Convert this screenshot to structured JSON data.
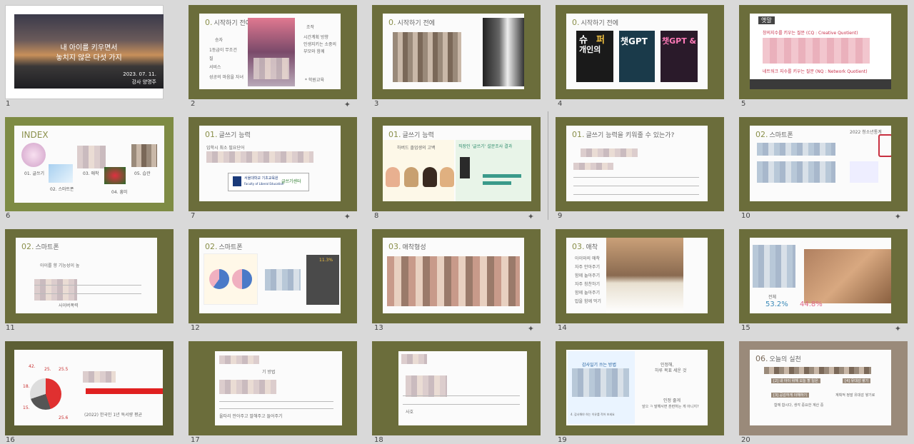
{
  "slides": [
    {
      "num": "1",
      "title_line1": "내 아이를 키우면서",
      "title_line2": "놓치지 않은 다섯 가지",
      "date": "2023. 07. 11.",
      "speaker": "강사  양명주"
    },
    {
      "num": "2",
      "section": "0.",
      "title": "시작하기 전에",
      "left_items": [
        "승자",
        "1등급이 무조건",
        "질",
        "서비스",
        "성공의 마음을 자녀"
      ],
      "right_head": "조작",
      "right_items": [
        "시간계획 방향",
        "인생지키는 소중의",
        "부모와 함께"
      ],
      "right_foot": "* 학원교육"
    },
    {
      "num": "3",
      "section": "0.",
      "title": "시작하기 전에"
    },
    {
      "num": "4",
      "section": "0.",
      "title": "시작하기 전에",
      "book1_a": "슈",
      "book1_b": "퍼",
      "book1_c": "개인의",
      "book2": "챗GPT",
      "book3": "챗GPT &"
    },
    {
      "num": "5",
      "head": "옛말",
      "line1": "창의지수를 키우는 질문 (CQ : Creative Quotient)",
      "line2": "네트워크 지수를 키우는 질문 (NQ : Network Quotient)"
    },
    {
      "num": "6",
      "title": "INDEX",
      "items": [
        "01. 글쓰기",
        "02. 스마트폰",
        "03. 애착",
        "04. 흥미",
        "05. 습관"
      ]
    },
    {
      "num": "7",
      "section": "01.",
      "title": "글쓰기 능력",
      "body": "입학시 최소 필요단어",
      "school": "서울대학교 기초교육원",
      "school_en": "Faculty of Liberal Education",
      "center": "글쓰기센터"
    },
    {
      "num": "8",
      "section": "01.",
      "title": "글쓰기 능력",
      "left_head": "하버드 졸업생의 고백",
      "right_head": "직장인 '글쓰기' 설문조사 결과"
    },
    {
      "num": "9",
      "section": "01.",
      "title": "글쓰기 능력을 키워줄 수 있는가?"
    },
    {
      "num": "10",
      "section": "02.",
      "title": "스마트폰",
      "note": "2022 청소년통계"
    },
    {
      "num": "11",
      "section": "02.",
      "title": "스마트폰",
      "body": "아이를 향 기능성이 높",
      "foot": "사이버폭력"
    },
    {
      "num": "12",
      "section": "02.",
      "title": "스마트폰",
      "value": "11.3%"
    },
    {
      "num": "13",
      "section": "03.",
      "title": "애착형성"
    },
    {
      "num": "14",
      "section": "03.",
      "title": "애착",
      "items": [
        "아이와의 애착",
        "자주 안아주기",
        "함께 놀아주기",
        "자주 칭찬하기",
        "함께 놀아주기",
        "밥을 함께 먹기"
      ]
    },
    {
      "num": "15",
      "value_a": "53.2%",
      "value_b": "44.8%",
      "label": "전체"
    },
    {
      "num": "16",
      "nums": [
        "42.",
        "25.",
        "25.5",
        "18.",
        "15.",
        "25.6"
      ],
      "foot": "(2022) 한국인 1년 독서량 평균"
    },
    {
      "num": "17",
      "title": "기 방법",
      "foot": "울타리 안아주고 말해주고 들어주기"
    },
    {
      "num": "18",
      "foot": "사호"
    },
    {
      "num": "19",
      "left_head": "감사일기 쓰는 방법",
      "right_a": "인정해,",
      "right_b": "하루 목표 세운 것",
      "right_c": "인정 줄게",
      "right_d": "앞으 ㅋ 말해서면 훈련하는 게 아니지?",
      "foot": "4. 감사해야 하는 이유를 적어 보세요"
    },
    {
      "num": "20",
      "section": "06.",
      "title": "오늘의 실천",
      "tag1": "[2] 내 아이 위해 오늘 할 일은",
      "tag2": "[4] 유대감 쌓기",
      "tag3": "[3] 공감하게 이해하기",
      "tag4": "계획적 정말 유대감 쌓기로",
      "tag5": "함께 합시다, 생각 중요한 계산 중"
    }
  ],
  "colors": {
    "olive": "#6b6d3b",
    "green": "#7e8b44",
    "brown": "#9a8a7a",
    "accent": "#8a8f4a"
  }
}
